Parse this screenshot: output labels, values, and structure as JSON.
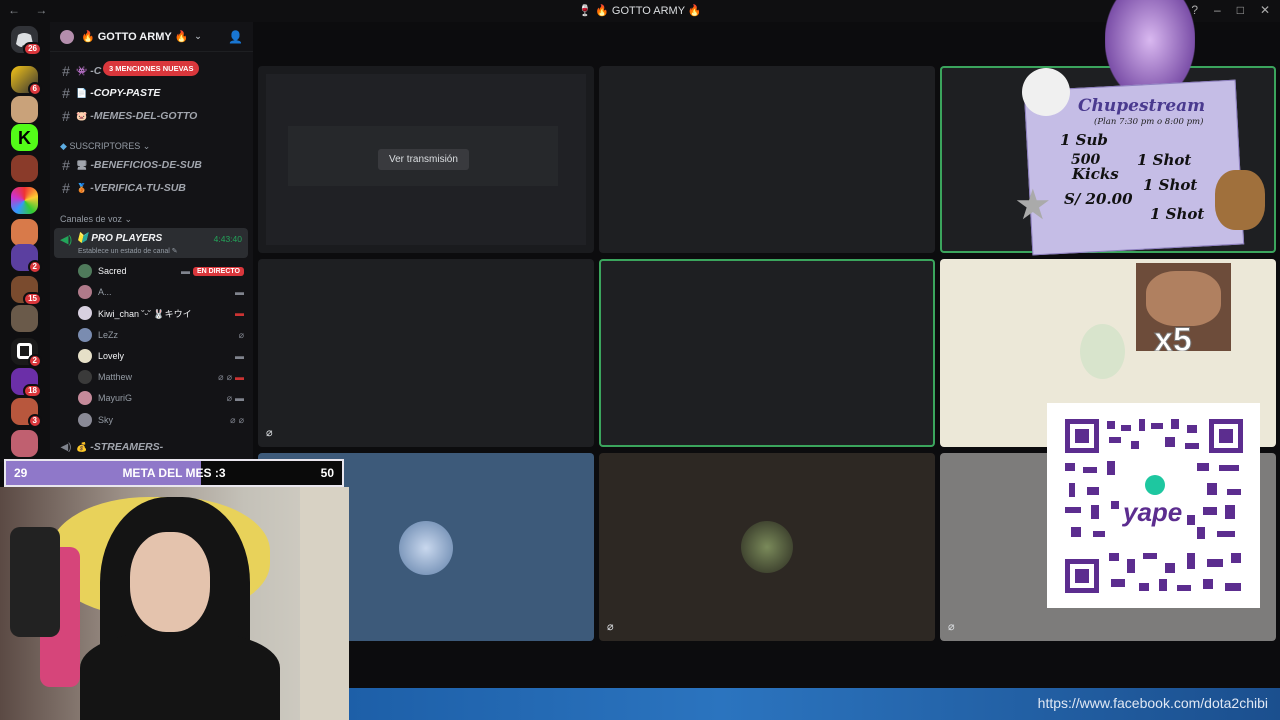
{
  "window": {
    "title": "🍷 🔥 GOTTO ARMY 🔥",
    "nav": "← →"
  },
  "rail": {
    "dm_badge": "26",
    "badges": [
      "6",
      "2",
      "15",
      "2",
      "18",
      "3"
    ]
  },
  "server": {
    "name": "🔥 GOTTO ARMY 🔥",
    "mention_pill": "3 MENCIONES NUEVAS",
    "channels": [
      {
        "emoji": "👾",
        "name": "-C"
      },
      {
        "emoji": "📄",
        "name": "-COPY-PASTE"
      },
      {
        "emoji": "🐷",
        "name": "-MEMES-DEL-GOTTO"
      }
    ],
    "subscribers_category": "SUSCRIPTORES",
    "sub_channels": [
      {
        "emoji": "🖥",
        "name": "-BENEFICIOS-DE-SUB"
      },
      {
        "emoji": "🥉",
        "name": "-VERIFICA-TU-SUB"
      }
    ],
    "voice_category": "Canales de voz",
    "voice_channel": {
      "name": "PRO PLAYERS",
      "status": "Establece un estado de canal",
      "time": "4:43:40"
    },
    "members": [
      {
        "name": "Sacred",
        "live": "EN DIRECTO",
        "bright": true
      },
      {
        "name": "A...",
        "bright": false
      },
      {
        "name": "Kiwi_chan ˘ᵕ˘ 🐰キウイ",
        "bright": false
      },
      {
        "name": "LeZz",
        "bright": false
      },
      {
        "name": "Lovely",
        "bright": true
      },
      {
        "name": "Matthew",
        "bright": false
      },
      {
        "name": "MayuriG",
        "bright": false
      },
      {
        "name": "Sky",
        "bright": false
      }
    ],
    "streamers_channel": "-STREAMERS-"
  },
  "grid": {
    "watch_stream_button": "Ver transmisión"
  },
  "overlay": {
    "goal_current": "29",
    "goal_label": "META DEL MES :3",
    "goal_target": "50",
    "goal_progress": 0.58,
    "url": "https://www.facebook.com/dota2chibi",
    "promo_title": "Chupestream",
    "promo_subtitle": "(Plan 7:30 pm o 8:00 pm)",
    "promo_lines": [
      "1 Sub",
      "1 Shot",
      "500",
      "Kicks",
      "1 Shot",
      "S/ 20.00",
      "1 Shot"
    ],
    "x5": "x5",
    "qr_brand": "yape"
  },
  "colors": {
    "accent_green": "#23a55a",
    "danger": "#da373c",
    "goal_fill": "#8f78c9"
  }
}
